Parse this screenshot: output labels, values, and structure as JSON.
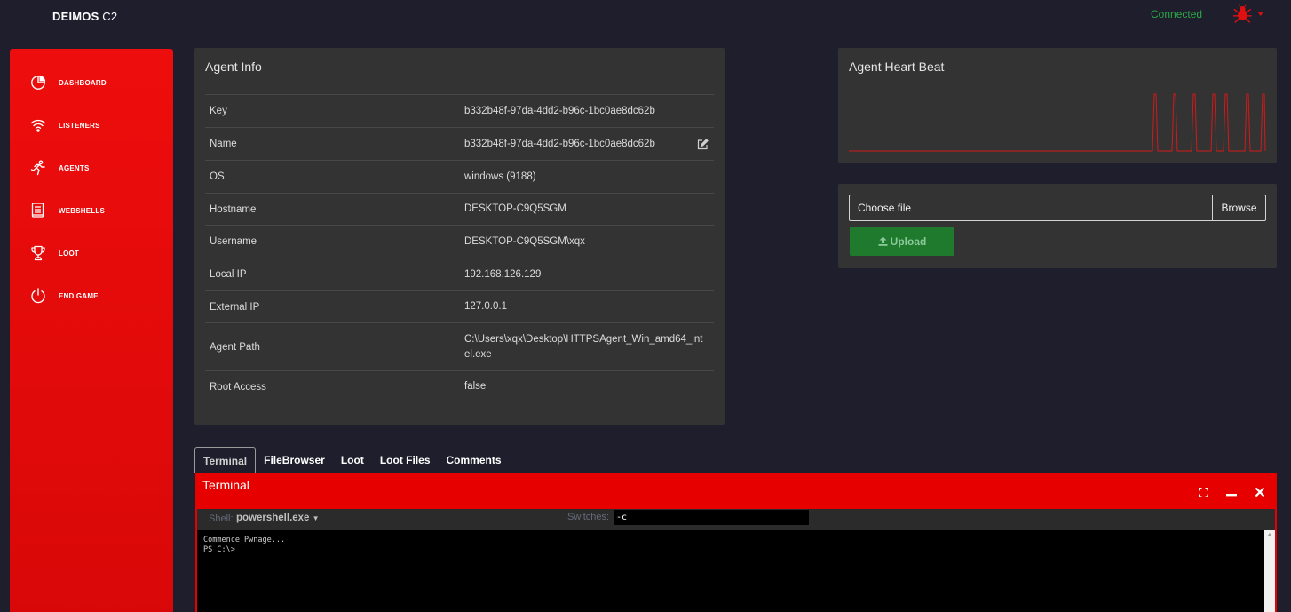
{
  "brand": {
    "bold": "DEIMOS",
    "rest": " C2"
  },
  "status": {
    "connection": "Connected"
  },
  "sidebar": {
    "items": [
      {
        "label": "DASHBOARD",
        "icon": "pie-chart-icon"
      },
      {
        "label": "LISTENERS",
        "icon": "wifi-icon"
      },
      {
        "label": "AGENTS",
        "icon": "running-figure-icon"
      },
      {
        "label": "WEBSHELLS",
        "icon": "document-icon"
      },
      {
        "label": "LOOT",
        "icon": "trophy-icon"
      },
      {
        "label": "END GAME",
        "icon": "power-icon"
      }
    ]
  },
  "agent_info": {
    "title": "Agent Info",
    "rows": [
      {
        "key": "Key",
        "value": "b332b48f-97da-4dd2-b96c-1bc0ae8dc62b"
      },
      {
        "key": "Name",
        "value": "b332b48f-97da-4dd2-b96c-1bc0ae8dc62b"
      },
      {
        "key": "OS",
        "value": "windows (9188)"
      },
      {
        "key": "Hostname",
        "value": "DESKTOP-C9Q5SGM"
      },
      {
        "key": "Username",
        "value": "DESKTOP-C9Q5SGM\\xqx"
      },
      {
        "key": "Local IP",
        "value": "192.168.126.129"
      },
      {
        "key": "External IP",
        "value": "127.0.0.1"
      },
      {
        "key": "Agent Path",
        "value": "C:\\Users\\xqx\\Desktop\\HTTPSAgent_Win_amd64_intel.exe"
      },
      {
        "key": "Root Access",
        "value": "false"
      }
    ]
  },
  "heartbeat": {
    "title": "Agent Heart Beat",
    "line_color": "#d11a1a"
  },
  "upload": {
    "file_placeholder": "Choose file",
    "browse_label": "Browse",
    "button_label": "Upload"
  },
  "tabs": [
    {
      "label": "Terminal",
      "active": true
    },
    {
      "label": "FileBrowser",
      "active": false
    },
    {
      "label": "Loot",
      "active": false
    },
    {
      "label": "Loot Files",
      "active": false
    },
    {
      "label": "Comments",
      "active": false
    }
  ],
  "terminal": {
    "title": "Terminal",
    "shell_label": "Shell:",
    "shell_value": "powershell.exe",
    "switches_label": "Switches:",
    "switches_value": "-c",
    "output_lines": [
      "Commence Pwnage...",
      "PS C:\\>"
    ]
  },
  "colors": {
    "accent_red": "#e60000",
    "connected_green": "#2aa845",
    "upload_green": "#1f7a2e",
    "background": "#1f1e2c",
    "panel": "#333333"
  }
}
